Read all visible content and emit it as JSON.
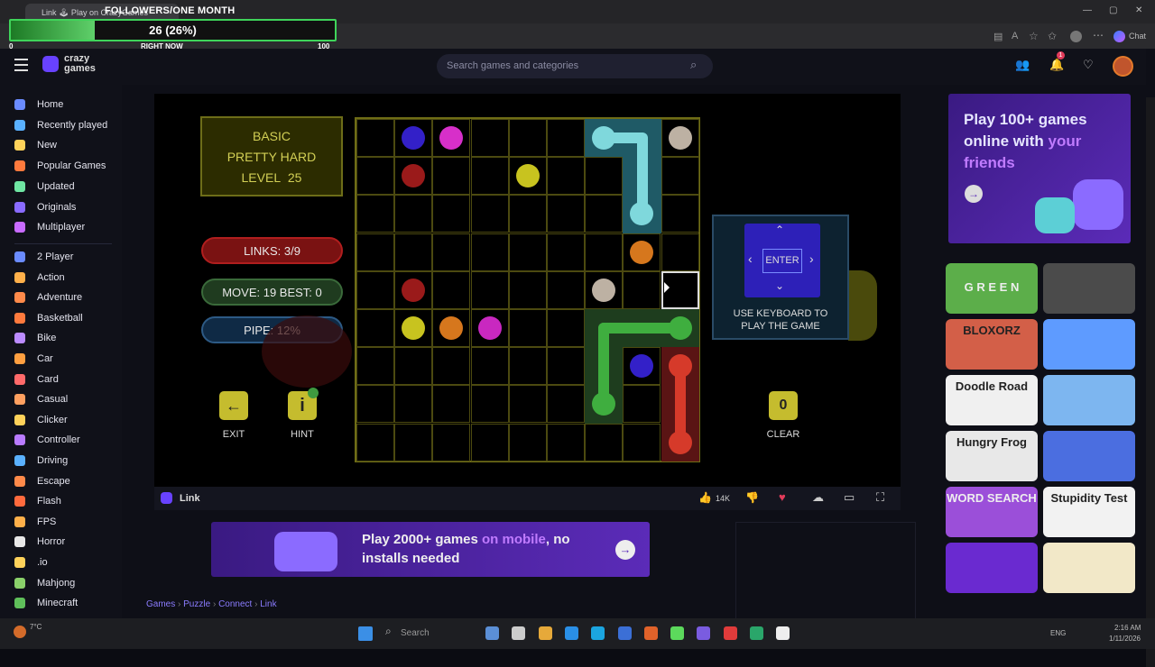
{
  "browser": {
    "tab_title": "Link 🕹 Play on CrazyGames",
    "chat_label": "Chat"
  },
  "overlay": {
    "title": "FOLLOWERS/ONE MONTH",
    "progress_fraction": 0.26,
    "value_text": "26 (26%)",
    "min_label": "0",
    "now_label": "RIGHT NOW",
    "max_label": "100"
  },
  "header": {
    "logo_top": "crazy",
    "logo_bottom": "games",
    "search_placeholder": "Search games and categories",
    "notif_count": "1"
  },
  "sidebar": {
    "items": [
      {
        "label": "Home",
        "color": "#6a8bff"
      },
      {
        "label": "Recently played",
        "color": "#5ab1ff"
      },
      {
        "label": "New",
        "color": "#ffd25a"
      },
      {
        "label": "Popular Games",
        "color": "#ff7a3d"
      },
      {
        "label": "Updated",
        "color": "#6fe6a3"
      },
      {
        "label": "Originals",
        "color": "#8a6bff"
      },
      {
        "label": "Multiplayer",
        "color": "#c86bff"
      }
    ],
    "categories": [
      {
        "label": "2 Player",
        "color": "#6a8bff"
      },
      {
        "label": "Action",
        "color": "#ffb04a"
      },
      {
        "label": "Adventure",
        "color": "#ff8a4a"
      },
      {
        "label": "Basketball",
        "color": "#ff7a3d"
      },
      {
        "label": "Bike",
        "color": "#bb8bff"
      },
      {
        "label": "Car",
        "color": "#ff9f40"
      },
      {
        "label": "Card",
        "color": "#ff6a6a"
      },
      {
        "label": "Casual",
        "color": "#ffa060"
      },
      {
        "label": "Clicker",
        "color": "#ffd25a"
      },
      {
        "label": "Controller",
        "color": "#b97bff"
      },
      {
        "label": "Driving",
        "color": "#5ab1ff"
      },
      {
        "label": "Escape",
        "color": "#ff8a4a"
      },
      {
        "label": "Flash",
        "color": "#ff6a3d"
      },
      {
        "label": "FPS",
        "color": "#ffb04a"
      },
      {
        "label": "Horror",
        "color": "#e8e8e8"
      },
      {
        "label": ".io",
        "color": "#ffd25a"
      },
      {
        "label": "Mahjong",
        "color": "#8ad06a"
      },
      {
        "label": "Minecraft",
        "color": "#5fbf5a"
      }
    ]
  },
  "game": {
    "mode": "BASIC",
    "difficulty": "PRETTY HARD",
    "level_label": "LEVEL",
    "level": "25",
    "links": "LINKS:   3/9",
    "move_best": "MOVE: 19   BEST: 0",
    "pipe": "PIPE:   12%",
    "exit_label": "EXIT",
    "hint_label": "HINT",
    "clear_label": "CLEAR",
    "clear_count": "0",
    "enter_label": "ENTER",
    "keyboard_hint_line1": "USE KEYBOARD TO",
    "keyboard_hint_line2": "PLAY THE GAME",
    "title": "Link",
    "likes": "14K"
  },
  "promo": {
    "right_top": "Play 100+ games online with your friends",
    "right_top_accent": "your friends",
    "mobile_prefix": "Play 2000+ games ",
    "mobile_accent": "on mobile",
    "mobile_suffix": ", no installs needed"
  },
  "breadcrumb": [
    "Games",
    "Puzzle",
    "Connect",
    "Link"
  ],
  "thumbs": [
    {
      "label": "G R E E N"
    },
    {
      "label": ""
    },
    {
      "label": "BLOXORZ"
    },
    {
      "label": ""
    },
    {
      "label": "Doodle Road"
    },
    {
      "label": ""
    },
    {
      "label": "Hungry Frog"
    },
    {
      "label": ""
    },
    {
      "label": "WORD SEARCH"
    },
    {
      "label": "Stupidity Test"
    },
    {
      "label": ""
    },
    {
      "label": ""
    }
  ],
  "taskbar": {
    "weather_temp": "7°C",
    "search_label": "Search",
    "lang": "ENG",
    "time": "2:16 AM",
    "date": "1/11/2026"
  }
}
